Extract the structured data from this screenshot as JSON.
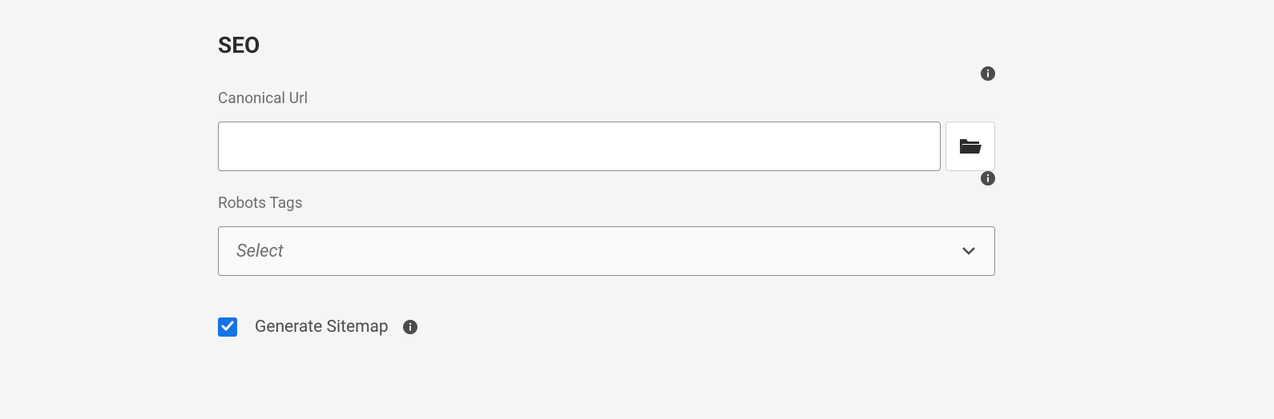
{
  "section": {
    "title": "SEO"
  },
  "canonical": {
    "label": "Canonical Url",
    "value": ""
  },
  "robots": {
    "label": "Robots Tags",
    "placeholder": "Select"
  },
  "sitemap": {
    "label": "Generate Sitemap",
    "checked": true
  }
}
